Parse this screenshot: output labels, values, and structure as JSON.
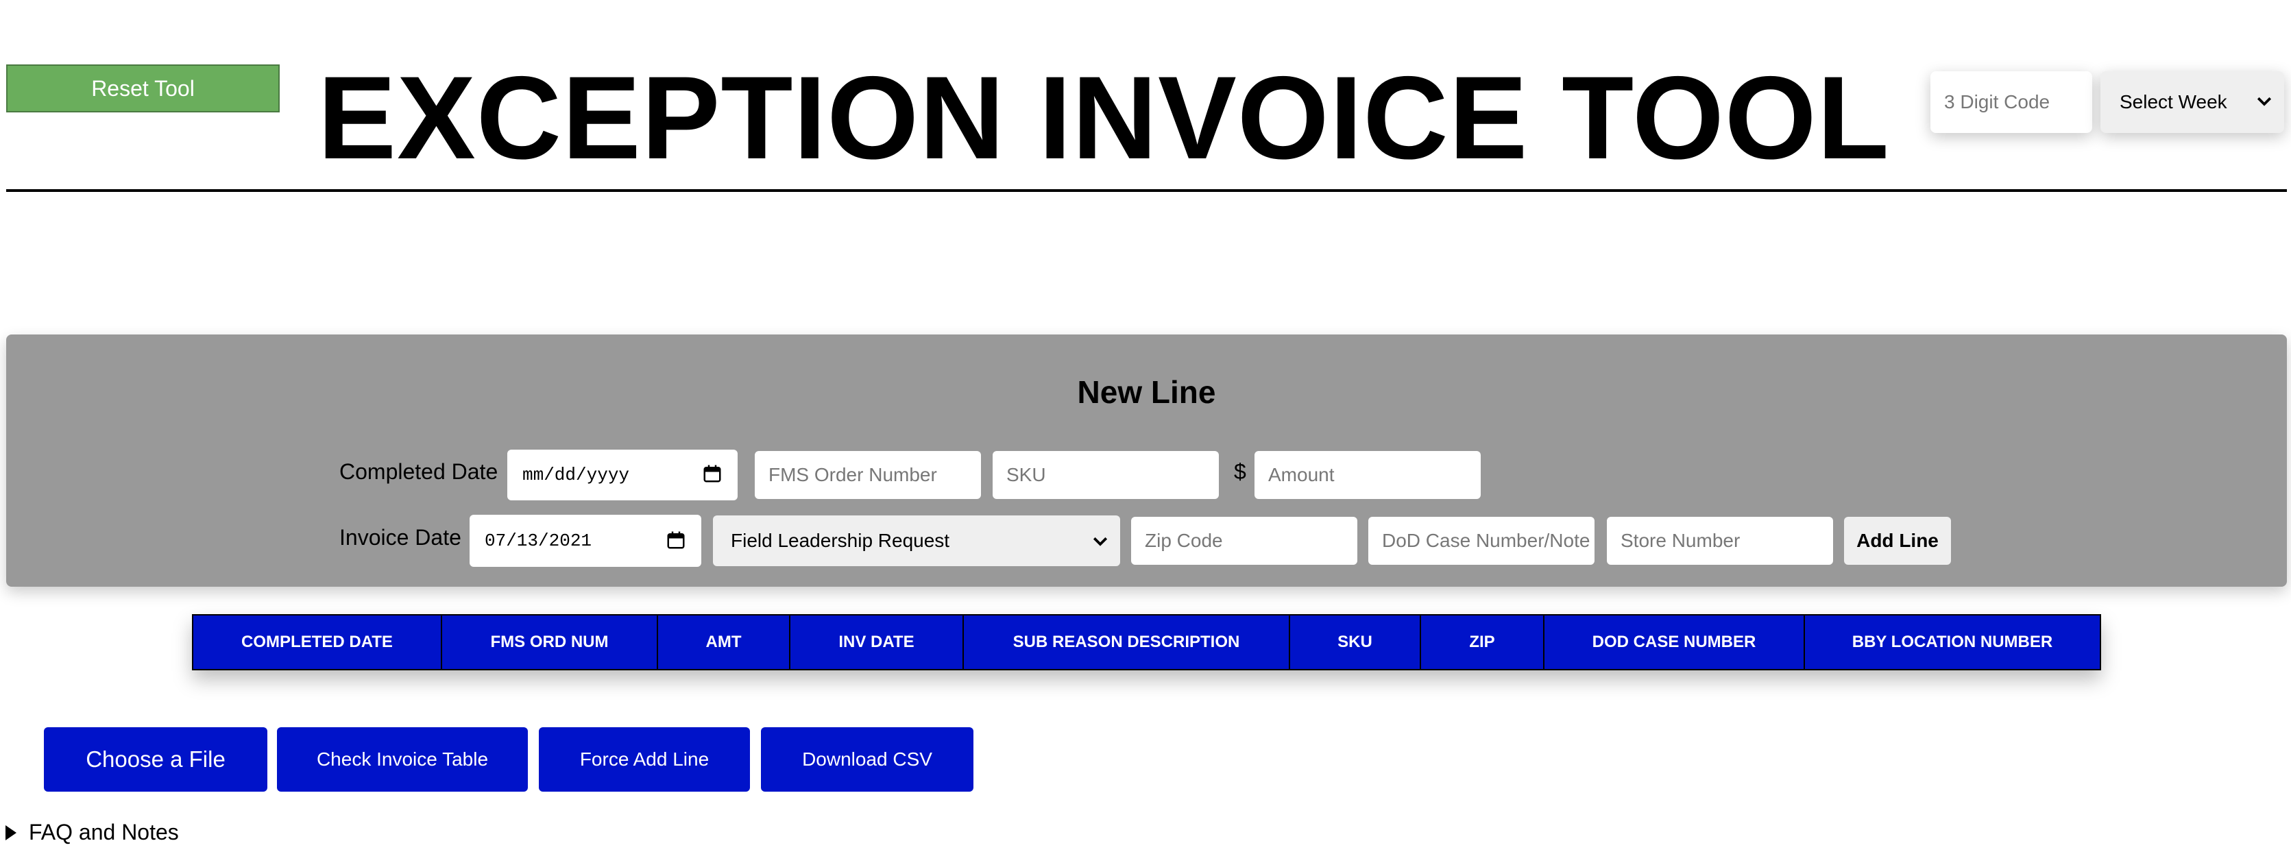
{
  "header": {
    "reset_label": "Reset Tool",
    "title": "EXCEPTION INVOICE TOOL",
    "code_placeholder": "3 Digit Code",
    "week_select_value": "Select Week"
  },
  "new_line": {
    "title": "New Line",
    "completed_date_label": "Completed Date",
    "completed_date_value": "mm/dd/yyyy",
    "fms_order_placeholder": "FMS Order Number",
    "sku_placeholder": "SKU",
    "currency_symbol": "$",
    "amount_placeholder": "Amount",
    "invoice_date_label": "Invoice Date",
    "invoice_date_value": "07/13/2021",
    "sub_reason_value": "Field Leadership Request",
    "zip_placeholder": "Zip Code",
    "dod_placeholder": "DoD Case Number/Note",
    "store_placeholder": "Store Number",
    "add_line_label": "Add Line"
  },
  "table": {
    "columns": [
      "COMPLETED DATE",
      "FMS ORD NUM",
      "AMT",
      "INV DATE",
      "SUB REASON DESCRIPTION",
      "SKU",
      "ZIP",
      "DOD CASE NUMBER",
      "BBY LOCATION NUMBER"
    ]
  },
  "actions": {
    "choose_file_label": "Choose a File",
    "check_table_label": "Check Invoice Table",
    "force_add_label": "Force Add Line",
    "download_csv_label": "Download CSV"
  },
  "faq": {
    "label": "FAQ and Notes"
  },
  "colors": {
    "reset_green": "#6aae5c",
    "panel_gray": "#999999",
    "primary_blue": "#0013c9"
  },
  "icons": {
    "dropdown": "chevron-down-icon",
    "date": "calendar-icon",
    "disclosure": "triangle-right-icon"
  }
}
